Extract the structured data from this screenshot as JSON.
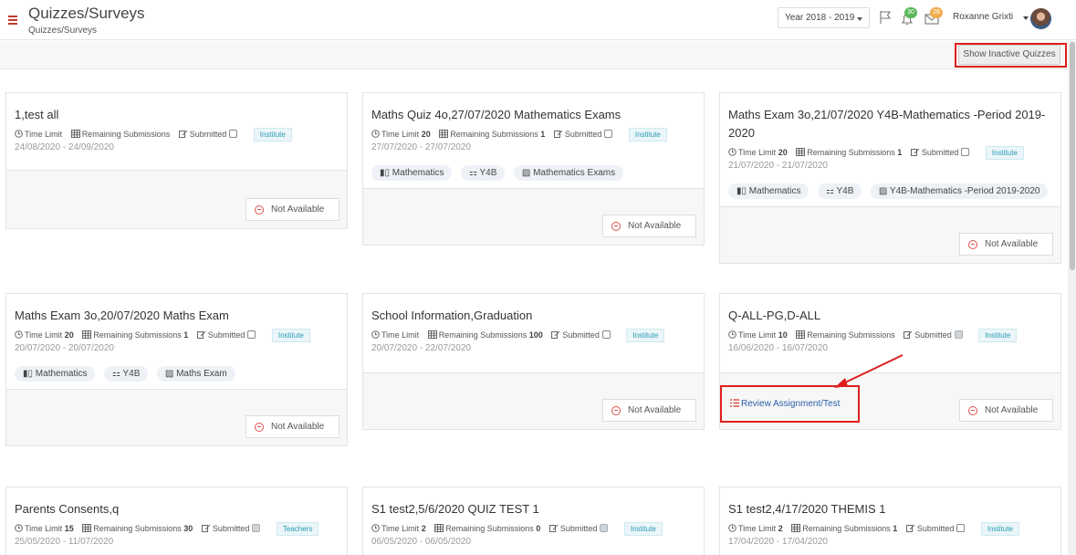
{
  "header": {
    "title": "Quizzes/Surveys",
    "breadcrumb": "Quizzes/Surveys",
    "year_select": "Year 2018 - 2019",
    "notifications_count": "30",
    "messages_count": "28",
    "user_name": "Roxanne Grixti",
    "icons": [
      "hamburger-icon",
      "flag-icon",
      "bell-icon",
      "envelope-icon",
      "avatar"
    ],
    "colors": {
      "notif_badge": "#5cb85c",
      "msg_badge": "#f0ad4e",
      "hamburger": "#c0392b"
    }
  },
  "toolbar": {
    "show_inactive_label": "Show Inactive Quizzes"
  },
  "labels": {
    "time_limit": "Time Limit",
    "remaining": "Remaining Submissions",
    "submitted": "Submitted",
    "not_available": "Not Available",
    "review": "Review Assignment/Test"
  },
  "cards": [
    {
      "title": "1,test all",
      "time_limit": "",
      "remaining": "",
      "submitted": false,
      "audience": "Institute",
      "dates": "24/08/2020 - 24/09/2020",
      "chips": []
    },
    {
      "title": "Maths Quiz 4o,27/07/2020 Mathematics Exams",
      "time_limit": "20",
      "remaining": "1",
      "submitted": false,
      "audience": "Institute",
      "dates": "27/07/2020 - 27/07/2020",
      "chips": [
        "Mathematics",
        "Y4B",
        "Mathematics Exams"
      ]
    },
    {
      "title": "Maths Exam 3o,21/07/2020 Y4B-Mathematics -Period 2019-2020",
      "time_limit": "20",
      "remaining": "1",
      "submitted": false,
      "audience": "Institute",
      "dates": "21/07/2020 - 21/07/2020",
      "chips": [
        "Mathematics",
        "Y4B",
        "Y4B-Mathematics -Period 2019-2020"
      ]
    },
    {
      "title": "Maths Exam 3o,20/07/2020 Maths Exam",
      "time_limit": "20",
      "remaining": "1",
      "submitted": false,
      "audience": "Institute",
      "dates": "20/07/2020 - 20/07/2020",
      "chips": [
        "Mathematics",
        "Y4B",
        "Maths Exam"
      ]
    },
    {
      "title": "School Information,Graduation",
      "time_limit": "",
      "remaining": "100",
      "submitted": false,
      "audience": "Institute",
      "dates": "20/07/2020 - 22/07/2020",
      "chips": []
    },
    {
      "title": "Q-ALL-PG,D-ALL",
      "time_limit": "10",
      "remaining": "",
      "submitted": true,
      "audience": "Institute",
      "dates": "16/06/2020 - 16/07/2020",
      "chips": []
    },
    {
      "title": "Parents Consents,q",
      "time_limit": "15",
      "remaining": "30",
      "submitted": true,
      "audience": "Teachers",
      "dates": "25/05/2020 - 11/07/2020",
      "chips": []
    },
    {
      "title": "S1 test2,5/6/2020 QUIZ TEST 1",
      "time_limit": "2",
      "remaining": "0",
      "submitted": true,
      "audience": "Institute",
      "dates": "06/05/2020 - 06/05/2020",
      "chips": []
    },
    {
      "title": "S1 test2,4/17/2020 THEMIS 1",
      "time_limit": "2",
      "remaining": "1",
      "submitted": false,
      "audience": "Institute",
      "dates": "17/04/2020 - 17/04/2020",
      "chips": []
    }
  ]
}
